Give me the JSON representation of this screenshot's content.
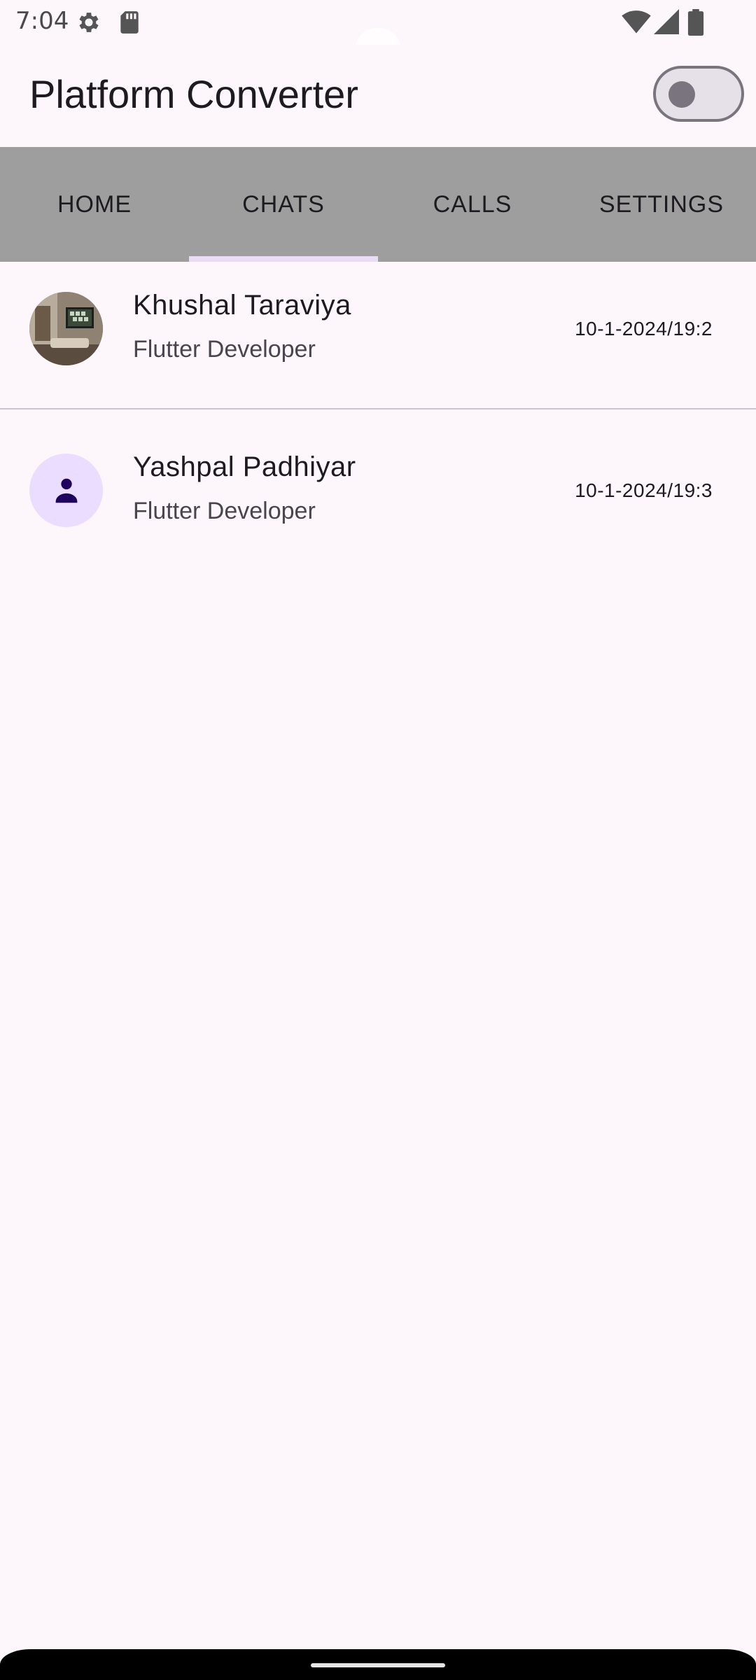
{
  "status_bar": {
    "time": "7:04",
    "left_icons": [
      "gear-icon",
      "sd-card-icon"
    ],
    "right_icons": [
      "wifi-icon",
      "cell-signal-icon",
      "battery-icon"
    ]
  },
  "app_bar": {
    "title": "Platform Converter",
    "toggle_on": false
  },
  "tabs": [
    {
      "label": "HOME",
      "selected": false
    },
    {
      "label": "CHATS",
      "selected": true
    },
    {
      "label": "CALLS",
      "selected": false
    },
    {
      "label": "SETTINGS",
      "selected": false
    }
  ],
  "chats": [
    {
      "name": "Khushal Taraviya",
      "subtitle": "Flutter Developer",
      "time": "10-1-2024/19:2",
      "avatar": "photo"
    },
    {
      "name": "Yashpal Padhiyar",
      "subtitle": "Flutter Developer",
      "time": "10-1-2024/19:3",
      "avatar": "person-icon"
    }
  ],
  "colors": {
    "background": "#fdf7fb",
    "tab_bar": "#9e9e9e",
    "tab_indicator": "#e8ddf5",
    "avatar_default_bg": "#eaddff",
    "person_icon": "#21005d"
  }
}
